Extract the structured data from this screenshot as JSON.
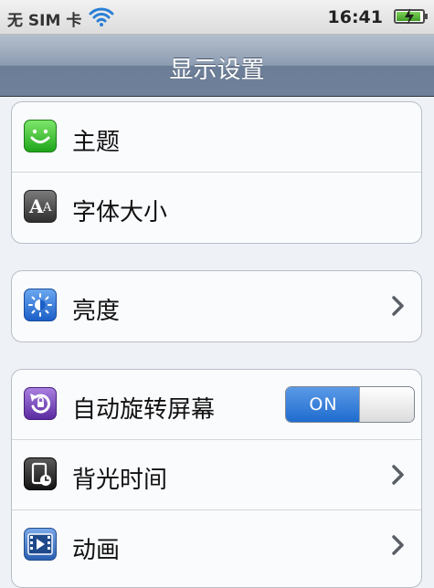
{
  "status_bar": {
    "carrier": "无 SIM 卡",
    "time": "16:41",
    "icons": [
      "wifi-icon",
      "battery-charging-icon"
    ]
  },
  "nav": {
    "title": "显示设置"
  },
  "groups": [
    {
      "items": [
        {
          "label": "主题",
          "icon": "smiley-icon"
        },
        {
          "label": "字体大小",
          "icon": "font-size-icon",
          "icon_text": "AA"
        }
      ]
    },
    {
      "items": [
        {
          "label": "亮度",
          "icon": "brightness-icon",
          "accessory": "chevron"
        }
      ]
    },
    {
      "items": [
        {
          "label": "自动旋转屏幕",
          "icon": "rotate-icon",
          "toggle": {
            "label": "ON",
            "state": "on"
          }
        },
        {
          "label": "背光时间",
          "icon": "backlight-timer-icon",
          "accessory": "chevron"
        },
        {
          "label": "动画",
          "icon": "animation-icon",
          "accessory": "chevron"
        }
      ]
    }
  ],
  "colors": {
    "nav_bar": "#7f90a7",
    "toggle_on": "#2b76d2",
    "background": "#eef1f6"
  }
}
